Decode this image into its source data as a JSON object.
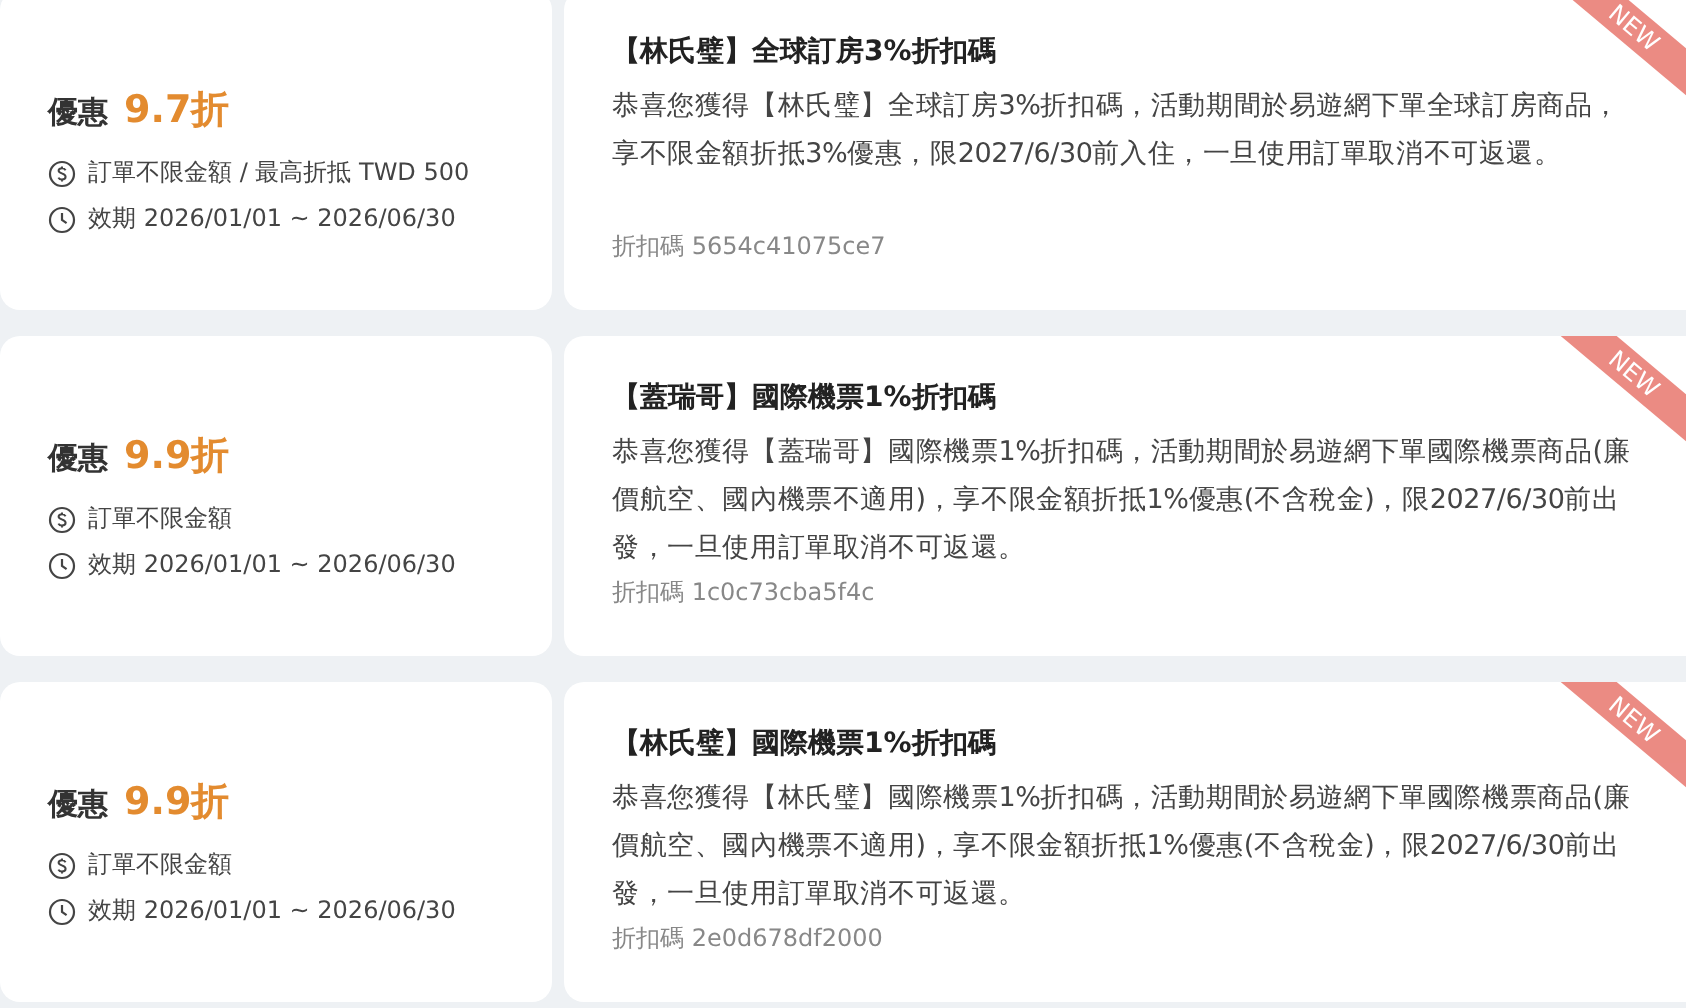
{
  "coupons": [
    {
      "label": "優惠",
      "discount": "9.7折",
      "limit": "訂單不限金額 / 最高折抵 TWD 500",
      "validity": "效期 2026/01/01 ~ 2026/06/30",
      "title": "【林氏璧】全球訂房3%折扣碼",
      "description": "恭喜您獲得【林氏璧】全球訂房3%折扣碼，活動期間於易遊網下單全球訂房商品，享不限金額折抵3%優惠，限2027/6/30前入住，一旦使用訂單取消不可返還。",
      "code": "折扣碼 5654c41075ce7",
      "badge": "NEW"
    },
    {
      "label": "優惠",
      "discount": "9.9折",
      "limit": "訂單不限金額",
      "validity": "效期 2026/01/01 ~ 2026/06/30",
      "title": "【蓋瑞哥】國際機票1%折扣碼",
      "description": "恭喜您獲得【蓋瑞哥】國際機票1%折扣碼，活動期間於易遊網下單國際機票商品(廉價航空、國內機票不適用)，享不限金額折抵1%優惠(不含稅金)，限2027/6/30前出發，一旦使用訂單取消不可返還。",
      "code": "折扣碼 1c0c73cba5f4c",
      "badge": "NEW"
    },
    {
      "label": "優惠",
      "discount": "9.9折",
      "limit": "訂單不限金額",
      "validity": "效期 2026/01/01 ~ 2026/06/30",
      "title": "【林氏璧】國際機票1%折扣碼",
      "description": "恭喜您獲得【林氏璧】國際機票1%折扣碼，活動期間於易遊網下單國際機票商品(廉價航空、國內機票不適用)，享不限金額折抵1%優惠(不含稅金)，限2027/6/30前出發，一旦使用訂單取消不可返還。",
      "code": "折扣碼 2e0d678df2000",
      "badge": "NEW"
    }
  ]
}
